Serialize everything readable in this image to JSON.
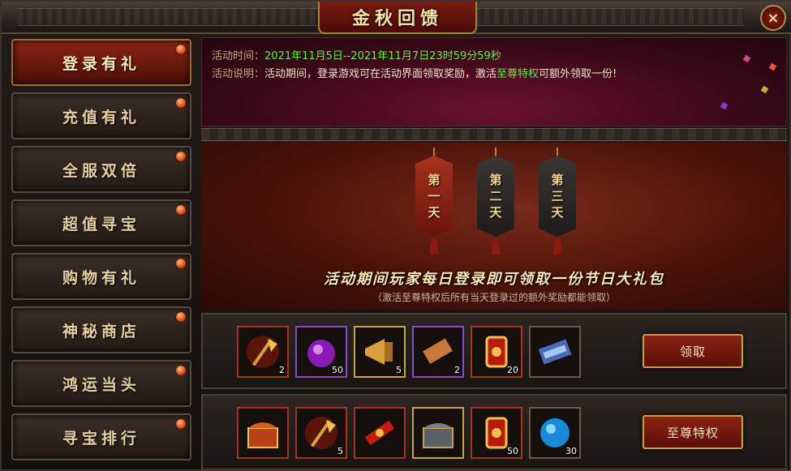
{
  "window": {
    "title": "金秋回馈",
    "close_icon": "×"
  },
  "sidebar": {
    "items": [
      {
        "label": "登录有礼",
        "active": true
      },
      {
        "label": "充值有礼"
      },
      {
        "label": "全服双倍"
      },
      {
        "label": "超值寻宝"
      },
      {
        "label": "购物有礼"
      },
      {
        "label": "神秘商店"
      },
      {
        "label": "鸿运当头"
      },
      {
        "label": "寻宝排行"
      }
    ]
  },
  "info": {
    "time_label": "活动时间：",
    "time_value": "2021年11月5日--2021年11月7日23时59分59秒",
    "desc_label": "活动说明：",
    "desc_prefix": "活动期间，登录游戏可在活动界面领取奖励，激活",
    "desc_highlight": "至尊特权",
    "desc_suffix": "可额外领取一份!"
  },
  "days": [
    {
      "chars": [
        "第",
        "一",
        "天"
      ],
      "state": "active"
    },
    {
      "chars": [
        "第",
        "二",
        "天"
      ],
      "state": "inactive"
    },
    {
      "chars": [
        "第",
        "三",
        "天"
      ],
      "state": "inactive"
    }
  ],
  "stage": {
    "headline": "活动期间玩家每日登录即可领取一份节日大礼包",
    "subline": "（激活至尊特权后所有当天登录过的额外奖励都能领取）"
  },
  "rewards_basic": {
    "items": [
      {
        "icon": "golden-axe-icon",
        "count": "2"
      },
      {
        "icon": "purple-orb-icon",
        "count": "50"
      },
      {
        "icon": "horn-icon",
        "count": "5"
      },
      {
        "icon": "scroll-icon",
        "count": "2"
      },
      {
        "icon": "red-token-icon",
        "count": "20"
      },
      {
        "icon": "blue-scroll-icon",
        "count": ""
      }
    ],
    "button": "领取"
  },
  "rewards_premium": {
    "items": [
      {
        "icon": "treasure-chest-red-icon",
        "count": ""
      },
      {
        "icon": "golden-axe-icon",
        "count": "5"
      },
      {
        "icon": "red-scroll-icon",
        "count": ""
      },
      {
        "icon": "silver-chest-icon",
        "count": ""
      },
      {
        "icon": "red-token-icon",
        "count": "50"
      },
      {
        "icon": "blue-gem-icon",
        "count": "30"
      }
    ],
    "button": "至尊特权"
  },
  "colors": {
    "accent_green": "#5ef04a",
    "gold": "#f0d48a",
    "frame_red": "#8a2214"
  }
}
